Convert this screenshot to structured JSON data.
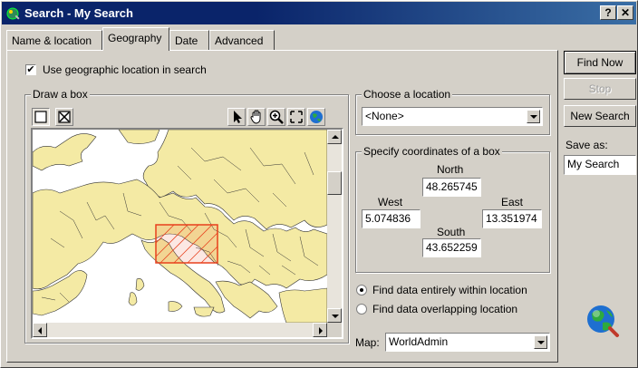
{
  "window": {
    "title": "Search - My Search",
    "help_label": "?",
    "close_label": "✕"
  },
  "tabs": [
    {
      "label": "Name & location"
    },
    {
      "label": "Geography"
    },
    {
      "label": "Date"
    },
    {
      "label": "Advanced"
    }
  ],
  "active_tab": "Geography",
  "geography": {
    "use_location_label": "Use geographic location in search",
    "use_location_checked": true,
    "draw_box_label": "Draw a box",
    "choose_location_label": "Choose a location",
    "choose_location_value": "<None>",
    "specify_coords_label": "Specify coordinates of a box",
    "north_label": "North",
    "north_value": "48.265745",
    "west_label": "West",
    "west_value": "5.074836",
    "east_label": "East",
    "east_value": "13.351974",
    "south_label": "South",
    "south_value": "43.652259",
    "radio_entirely_label": "Find data entirely within location",
    "radio_overlapping_label": "Find data overlapping location",
    "selected_radio": "entirely",
    "map_label": "Map:",
    "map_value": "WorldAdmin"
  },
  "side_buttons": {
    "find_now": "Find Now",
    "stop": "Stop",
    "new_search": "New Search",
    "save_as_label": "Save as:",
    "save_as_value": "My Search"
  },
  "tools": [
    "rectangle-icon",
    "clear-box-icon",
    "pointer-icon",
    "pan-hand-icon",
    "zoom-in-icon",
    "full-extent-icon",
    "globe-icon"
  ],
  "colors": {
    "land": "#f4eaa4",
    "water": "#ffffff",
    "selection": "#e8401c",
    "titlebar": "#0a246a"
  }
}
